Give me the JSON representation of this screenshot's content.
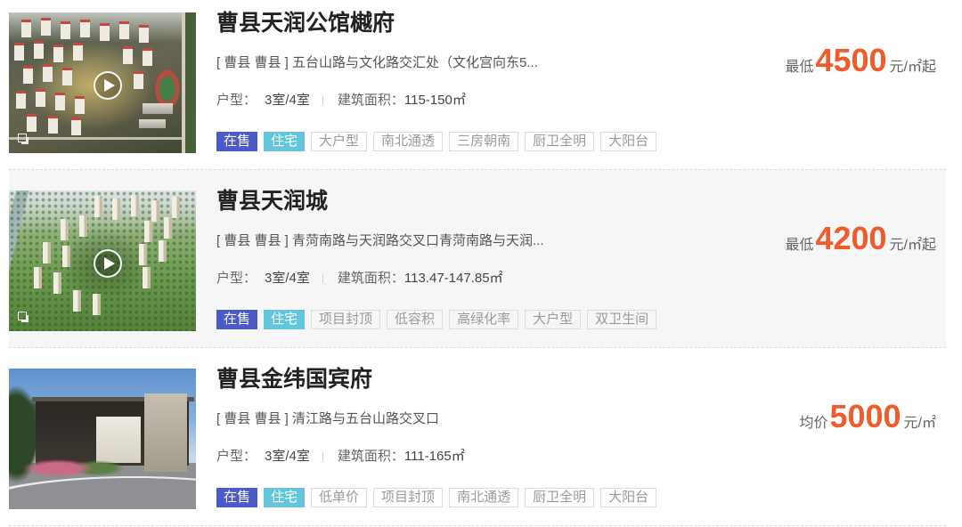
{
  "colors": {
    "price": "#ef5b2c",
    "status_tag_bg": "#4a5ac6",
    "type_tag_bg": "#62c5dc"
  },
  "listings": [
    {
      "title": "曹县天润公馆樾府",
      "address": "[ 曹县 曹县 ] 五台山路与文化路交汇处（文化宫向东5...",
      "layout_label": "户型：",
      "layout_value": "3室/4室",
      "area_label": "建筑面积：",
      "area_value": "115-150㎡",
      "status_tag": "在售",
      "type_tag": "住宅",
      "tags": [
        "大户型",
        "南北通透",
        "三房朝南",
        "厨卫全明",
        "大阳台"
      ],
      "price_prefix": "最低",
      "price": "4500",
      "price_unit": "元/㎡起",
      "thumbnail_icons": [
        "play-icon",
        "gallery-icon"
      ]
    },
    {
      "title": "曹县天润城",
      "address": "[ 曹县 曹县 ] 青菏南路与天润路交叉口青菏南路与天润...",
      "layout_label": "户型：",
      "layout_value": "3室/4室",
      "area_label": "建筑面积：",
      "area_value": "113.47-147.85㎡",
      "status_tag": "在售",
      "type_tag": "住宅",
      "tags": [
        "项目封顶",
        "低容积",
        "高绿化率",
        "大户型",
        "双卫生间"
      ],
      "price_prefix": "最低",
      "price": "4200",
      "price_unit": "元/㎡起",
      "thumbnail_icons": [
        "play-icon",
        "gallery-icon"
      ]
    },
    {
      "title": "曹县金纬国宾府",
      "address": "[ 曹县 曹县 ] 清江路与五台山路交叉口",
      "layout_label": "户型：",
      "layout_value": "3室/4室",
      "area_label": "建筑面积：",
      "area_value": "111-165㎡",
      "status_tag": "在售",
      "type_tag": "住宅",
      "tags": [
        "低单价",
        "项目封顶",
        "南北通透",
        "厨卫全明",
        "大阳台"
      ],
      "price_prefix": "均价",
      "price": "5000",
      "price_unit": "元/㎡",
      "thumbnail_icons": []
    }
  ]
}
